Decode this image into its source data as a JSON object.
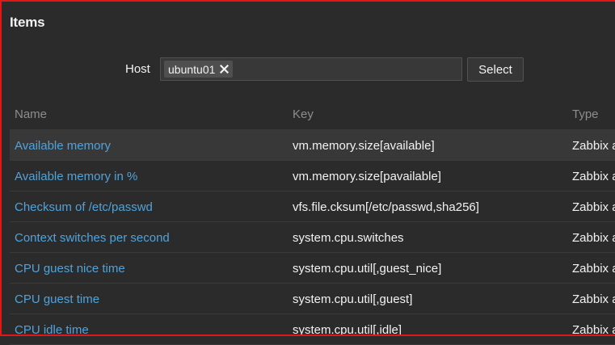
{
  "page": {
    "title": "Items"
  },
  "filter": {
    "host_label": "Host",
    "host_chip": "ubuntu01",
    "select_label": "Select"
  },
  "table": {
    "columns": [
      "Name",
      "Key",
      "Type"
    ],
    "rows": [
      {
        "name": "Available memory",
        "key": "vm.memory.size[available]",
        "type": "Zabbix a"
      },
      {
        "name": "Available memory in %",
        "key": "vm.memory.size[pavailable]",
        "type": "Zabbix a"
      },
      {
        "name": "Checksum of /etc/passwd",
        "key": "vfs.file.cksum[/etc/passwd,sha256]",
        "type": "Zabbix a"
      },
      {
        "name": "Context switches per second",
        "key": "system.cpu.switches",
        "type": "Zabbix a"
      },
      {
        "name": "CPU guest nice time",
        "key": "system.cpu.util[,guest_nice]",
        "type": "Zabbix a"
      },
      {
        "name": "CPU guest time",
        "key": "system.cpu.util[,guest]",
        "type": "Zabbix a"
      },
      {
        "name": "CPU idle time",
        "key": "system.cpu.util[,idle]",
        "type": "Zabbix a"
      }
    ]
  }
}
